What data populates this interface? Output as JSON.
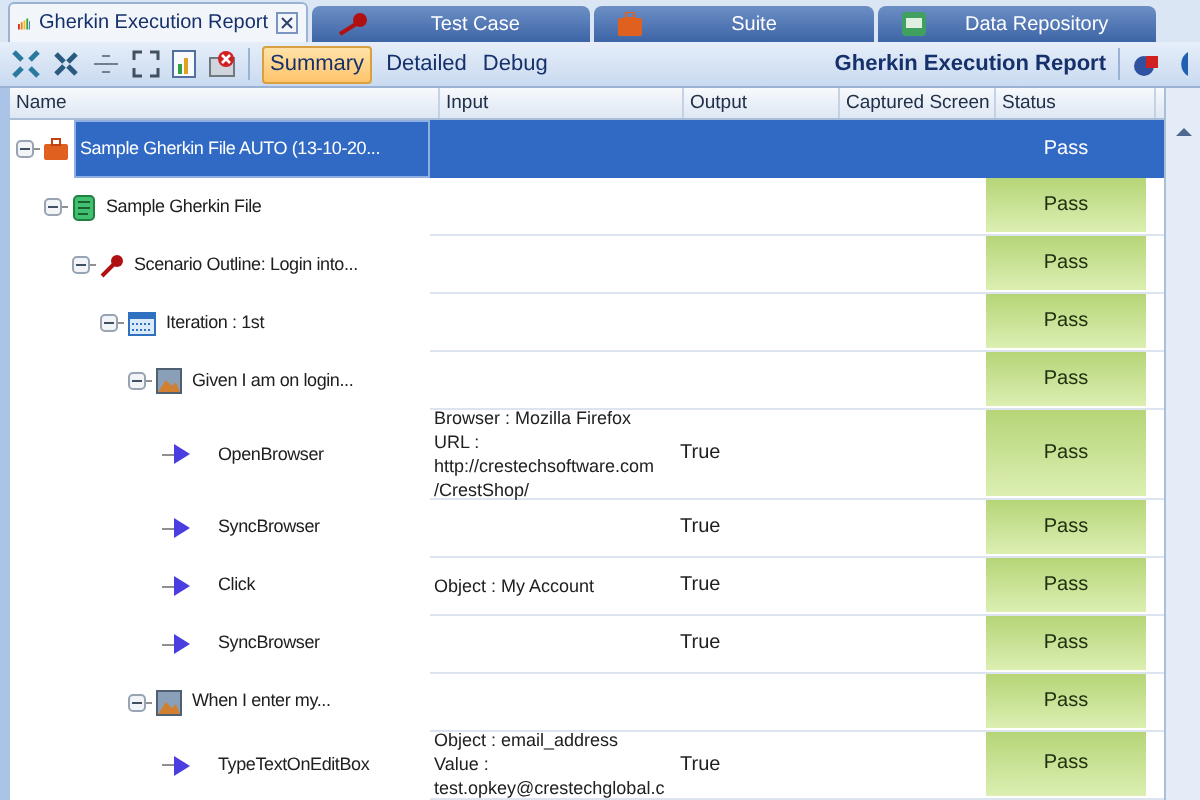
{
  "tabs": [
    {
      "label": "Gherkin Execution Report",
      "kind": "chart",
      "selected": true
    },
    {
      "label": "Test Case",
      "kind": "key",
      "selected": false
    },
    {
      "label": "Suite",
      "kind": "suite",
      "selected": false
    },
    {
      "label": "Data Repository",
      "kind": "data",
      "selected": false
    }
  ],
  "toolbar": {
    "views": [
      {
        "label": "Summary",
        "selected": true
      },
      {
        "label": "Detailed",
        "selected": false
      },
      {
        "label": "Debug",
        "selected": false
      }
    ],
    "title": "Gherkin Execution Report"
  },
  "table": {
    "columns": [
      "Name",
      "Input",
      "Output",
      "Captured Screen",
      "Status"
    ],
    "rows": [
      {
        "kind": "suite",
        "name": "Sample Gherkin File AUTO (13-10-20...",
        "status": "Pass",
        "selected": true,
        "expanded": true,
        "children": [
          {
            "kind": "file",
            "name": "Sample Gherkin File",
            "status": "Pass",
            "selected": false,
            "expanded": true,
            "children": [
              {
                "kind": "scenario",
                "name": "Scenario Outline: Login into...",
                "status": "Pass",
                "selected": false,
                "expanded": true,
                "children": [
                  {
                    "kind": "iteration",
                    "name": "Iteration : 1st",
                    "status": "Pass",
                    "selected": false,
                    "expanded": true,
                    "children": [
                      {
                        "kind": "step",
                        "name": "Given I am on login...",
                        "status": "Pass",
                        "selected": false,
                        "expanded": true,
                        "children": [
                          {
                            "kind": "action",
                            "name": "OpenBrowser",
                            "input": [
                              "Browser : Mozilla Firefox",
                              "URL :",
                              "http://crestechsoftware.com",
                              "/CrestShop/"
                            ],
                            "output": "True",
                            "status": "Pass",
                            "selected": false
                          },
                          {
                            "kind": "action",
                            "name": "SyncBrowser",
                            "output": "True",
                            "status": "Pass",
                            "selected": false
                          },
                          {
                            "kind": "action",
                            "name": "Click",
                            "input": [
                              "Object : My Account"
                            ],
                            "output": "True",
                            "status": "Pass",
                            "selected": false
                          },
                          {
                            "kind": "action",
                            "name": "SyncBrowser",
                            "output": "True",
                            "status": "Pass",
                            "selected": false
                          }
                        ]
                      },
                      {
                        "kind": "step",
                        "name": "When I enter my...",
                        "status": "Pass",
                        "selected": false,
                        "expanded": true,
                        "children": [
                          {
                            "kind": "action",
                            "name": "TypeTextOnEditBox",
                            "input": [
                              "Object : email_address",
                              "Value :",
                              "test.opkey@crestechglobal.c"
                            ],
                            "output": "True",
                            "status": "Pass",
                            "selected": false
                          }
                        ]
                      }
                    ]
                  }
                ]
              }
            ]
          }
        ]
      }
    ]
  }
}
